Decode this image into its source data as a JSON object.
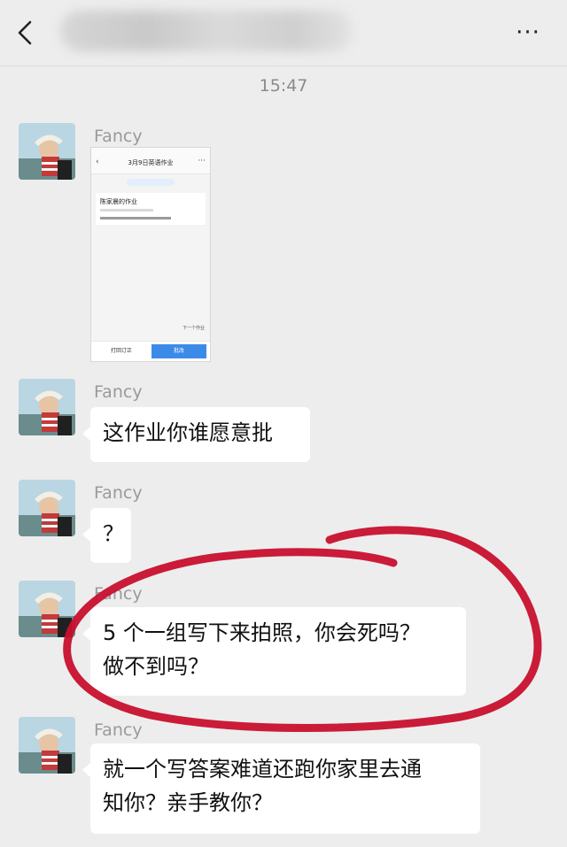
{
  "header": {
    "back_icon": "chevron-left-icon",
    "title": "",
    "more_label": "···"
  },
  "timestamp": "15:47",
  "messages": [
    {
      "sender": "Fancy",
      "type": "image",
      "image": {
        "nav_back": "‹",
        "nav_title": "3月9日英语作业",
        "nav_more": "···",
        "pill_text": "",
        "card_title": "陈家晨的作业",
        "fab_text": "下一个作业",
        "button_left": "打回订正",
        "button_right": "批改"
      }
    },
    {
      "sender": "Fancy",
      "type": "text",
      "text": "这作业你谁愿意批"
    },
    {
      "sender": "Fancy",
      "type": "text",
      "text": "？"
    },
    {
      "sender": "Fancy",
      "type": "text",
      "lines": [
        "5 个一组写下来拍照，你会死吗？",
        "做不到吗？"
      ]
    },
    {
      "sender": "Fancy",
      "type": "text",
      "lines": [
        "就一个写答案难道还跑你家里去通",
        "知你？亲手教你？"
      ]
    }
  ],
  "colors": {
    "background": "#ededed",
    "bubble": "#ffffff",
    "annotation_circle": "#c8102e",
    "accent_blue": "#3c8ae8"
  }
}
